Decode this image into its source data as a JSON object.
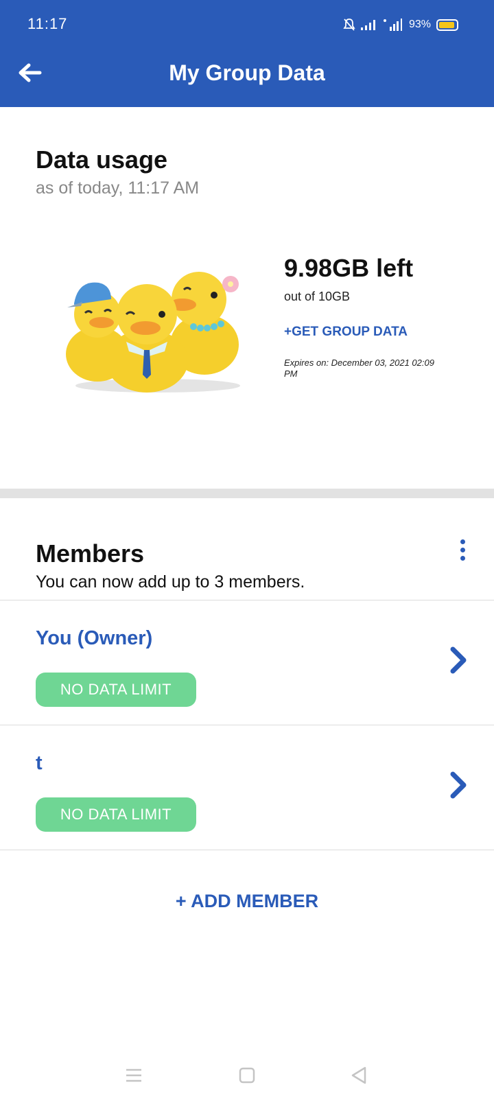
{
  "status_bar": {
    "time": "11:17",
    "battery_text": "93%",
    "battery_level": 0.93,
    "icons": [
      "mute-bell-icon",
      "signal-icon",
      "wifi-signal-icon",
      "battery-icon"
    ]
  },
  "appbar": {
    "title": "My Group Data",
    "back_icon": "back-arrow-icon",
    "color": "#2a5bb8"
  },
  "usage": {
    "title": "Data usage",
    "subtitle": "as of today, 11:17 AM",
    "remaining": "9.98GB left",
    "total": "out of 10GB",
    "get_group_data": "+GET GROUP DATA",
    "expires": "Expires on: December 03, 2021 02:09 PM",
    "illustration": "three-ducks-illustration"
  },
  "members": {
    "title": "Members",
    "subtitle": "You can now add up to 3 members.",
    "menu_icon": "more-vert-icon",
    "list": [
      {
        "name": "You (Owner)",
        "limit": "NO DATA LIMIT"
      },
      {
        "name": "t",
        "limit": "NO DATA LIMIT"
      }
    ],
    "add_label": "+ ADD MEMBER",
    "pill_color": "#6fd694"
  },
  "nav": {
    "icons": [
      "menu-icon",
      "home-square-icon",
      "back-triangle-icon"
    ]
  }
}
